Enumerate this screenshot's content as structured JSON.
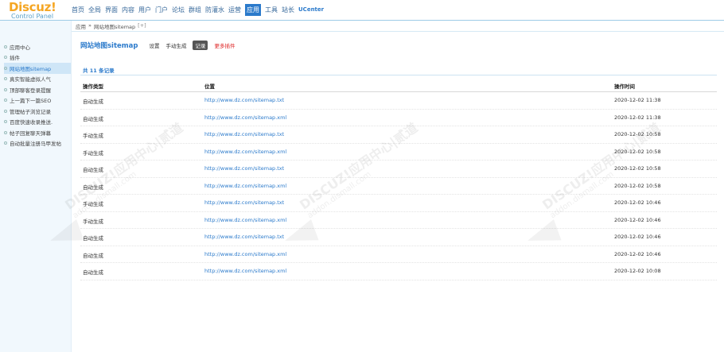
{
  "logo": {
    "brand": "Discuz!",
    "subtitle": "Control Panel"
  },
  "nav": [
    "首页",
    "全局",
    "界面",
    "内容",
    "用户",
    "门户",
    "论坛",
    "群组",
    "防灌水",
    "运营",
    "应用",
    "工具",
    "站长"
  ],
  "nav_uc": "UCenter",
  "nav_active_index": 10,
  "breadcrumb": {
    "part1": "应用",
    "sep": "»",
    "part2": "网站地图sitemap",
    "plus": "[+]"
  },
  "sidebar": {
    "items": [
      "应用中心",
      "插件",
      "网站地图sitemap",
      "真实智能虚拟人气",
      "顶部聊客登录提醒",
      "上一篇下一篇SEO",
      "管理帖子浏览记录",
      "百度快速收录推送.",
      "帖子回复聊天弹幕",
      "自动批量注册马甲发帖"
    ],
    "active_index": 2
  },
  "page": {
    "title": "网站地图sitemap",
    "tabs": [
      "设置",
      "手动生成",
      "记录",
      "更多插件"
    ],
    "active_tab": 2,
    "count_text": "共 11 条记录"
  },
  "table": {
    "headers": [
      "操作类型",
      "位置",
      "操作时间"
    ],
    "rows": [
      [
        "自动生成",
        "http://www.dz.com/sitemap.txt",
        "2020-12-02 11:38"
      ],
      [
        "自动生成",
        "http://www.dz.com/sitemap.xml",
        "2020-12-02 11:38"
      ],
      [
        "手动生成",
        "http://www.dz.com/sitemap.txt",
        "2020-12-02 10:58"
      ],
      [
        "手动生成",
        "http://www.dz.com/sitemap.xml",
        "2020-12-02 10:58"
      ],
      [
        "自动生成",
        "http://www.dz.com/sitemap.txt",
        "2020-12-02 10:58"
      ],
      [
        "自动生成",
        "http://www.dz.com/sitemap.xml",
        "2020-12-02 10:58"
      ],
      [
        "手动生成",
        "http://www.dz.com/sitemap.txt",
        "2020-12-02 10:46"
      ],
      [
        "手动生成",
        "http://www.dz.com/sitemap.xml",
        "2020-12-02 10:46"
      ],
      [
        "自动生成",
        "http://www.dz.com/sitemap.txt",
        "2020-12-02 10:46"
      ],
      [
        "自动生成",
        "http://www.dz.com/sitemap.xml",
        "2020-12-02 10:46"
      ],
      [
        "自动生成",
        "http://www.dz.com/sitemap.xml",
        "2020-12-02 10:08"
      ]
    ]
  },
  "watermark": {
    "main": "DISCUZ!应用中心|贰道",
    "domain": "addon.dismall.com"
  }
}
